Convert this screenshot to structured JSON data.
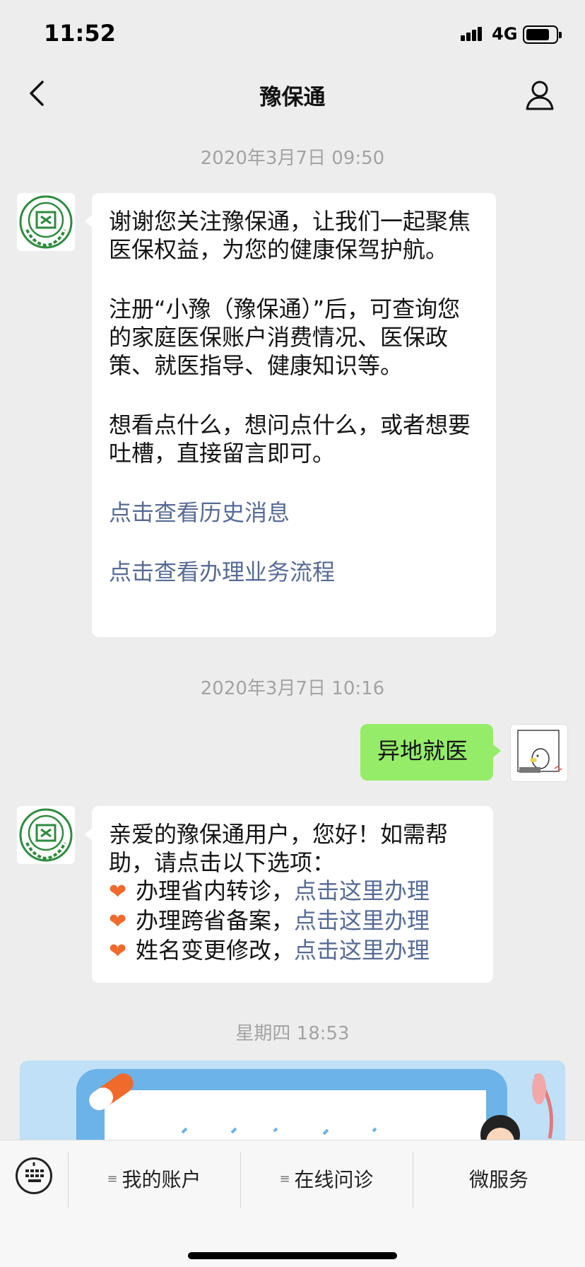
{
  "status_bar": {
    "time": "11:52",
    "network": "4G"
  },
  "nav": {
    "title": "豫保通"
  },
  "timestamps": [
    "2020年3月7日 09:50",
    "2020年3月7日 10:16",
    "星期四 18:53"
  ],
  "messages": {
    "welcome": {
      "line1": "谢谢您关注豫保通，让我们一起聚焦医保权益，为您的健康保驾护航。",
      "line2": "注册“小豫（豫保通）”后，可查询您的家庭医保账户消费情况、医保政策、就医指导、健康知识等。",
      "line3": " 想看点什么，想问点什么，或者想要吐槽，直接留言即可。",
      "link1": "点击查看历史消息",
      "link2": "点击查看办理业务流程"
    },
    "user_message": "异地就医",
    "reply": {
      "intro": "亲爱的豫保通用户，您好！如需帮助，请点击以下选项：",
      "options": [
        {
          "text": "办理省内转诊，",
          "link": "点击这里办理"
        },
        {
          "text": "办理跨省备案，",
          "link": "点击这里办理"
        },
        {
          "text": "姓名变更修改，",
          "link": "点击这里办理"
        }
      ]
    }
  },
  "menu": {
    "item1": "我的账户",
    "item2": "在线问诊",
    "item3": "微服务"
  },
  "colors": {
    "user_bubble": "#95ec69",
    "link": "#576b95",
    "logo_green": "#2e8b3e"
  },
  "icons": [
    "back-chevron-icon",
    "profile-icon",
    "keyboard-icon",
    "heart-icon",
    "menu-glyph-icon"
  ]
}
